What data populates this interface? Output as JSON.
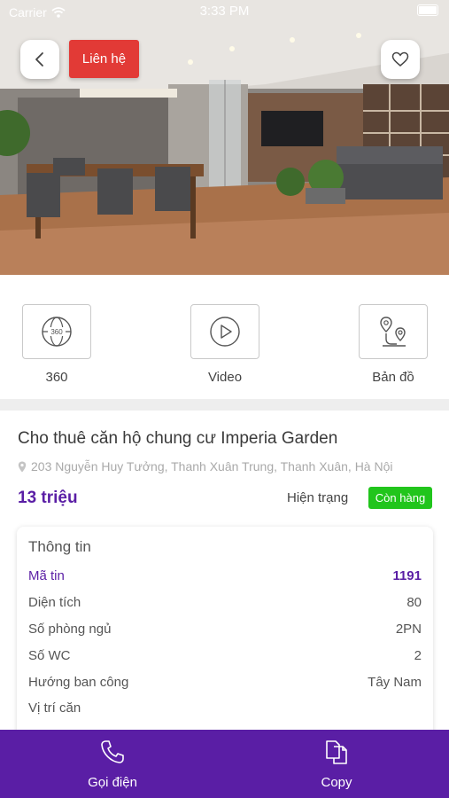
{
  "status_bar": {
    "carrier": "Carrier",
    "time": "3:33 PM"
  },
  "header": {
    "contact_label": "Liên hệ",
    "back_icon": "chevron-left-icon",
    "favorite_icon": "heart-icon"
  },
  "media_options": [
    {
      "label": "360",
      "icon": "panorama-360-icon"
    },
    {
      "label": "Video",
      "icon": "play-icon"
    },
    {
      "label": "Bản đồ",
      "icon": "map-route-icon"
    }
  ],
  "listing": {
    "title": "Cho thuê căn hộ chung cư Imperia Garden",
    "address": "203 Nguyễn Huy Tưởng, Thanh Xuân Trung, Thanh Xuân, Hà Nội",
    "price": "13 triệu",
    "status_label": "Hiện trạng",
    "status_value": "Còn hàng"
  },
  "info": {
    "title": "Thông tin",
    "rows": [
      {
        "key": "Mã tin",
        "value": "1191"
      },
      {
        "key": "Diện tích",
        "value": "80"
      },
      {
        "key": "Số phòng ngủ",
        "value": "2PN"
      },
      {
        "key": "Số WC",
        "value": "2"
      },
      {
        "key": "Hướng ban công",
        "value": "Tây Nam"
      },
      {
        "key": "Vị trí căn",
        "value": ""
      }
    ]
  },
  "actions": {
    "call_label": "Gọi điện",
    "copy_label": "Copy"
  },
  "colors": {
    "brand_purple": "#5a1ea5",
    "contact_red": "#e23a36",
    "status_green": "#21c51c"
  }
}
